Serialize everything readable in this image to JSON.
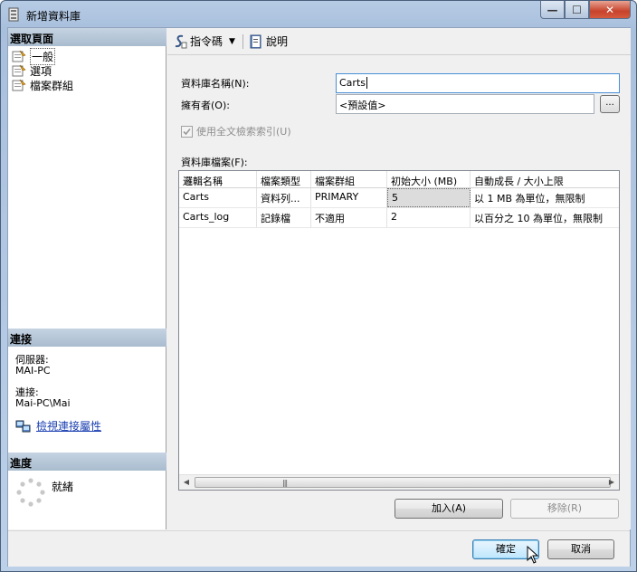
{
  "window": {
    "title": "新增資料庫",
    "buttons": {
      "minimize": "—",
      "maximize": "☐",
      "close": "✕"
    }
  },
  "left_pane": {
    "select_page": {
      "header": "選取頁面",
      "items": [
        {
          "label": "一般",
          "icon": "page-settings-icon",
          "selected": true
        },
        {
          "label": "選項",
          "icon": "page-settings-icon",
          "selected": false
        },
        {
          "label": "檔案群組",
          "icon": "page-settings-icon",
          "selected": false
        }
      ]
    },
    "connection": {
      "header": "連接",
      "server_label": "伺服器:",
      "server_value": "MAI-PC",
      "connection_label": "連接:",
      "connection_value": "Mai-PC\\Mai",
      "view_properties_link": "檢視連接屬性"
    },
    "progress": {
      "header": "進度",
      "status": "就緒"
    }
  },
  "toolbar": {
    "script_label": "指令碼",
    "help_label": "說明"
  },
  "form": {
    "db_name_label": "資料庫名稱(N):",
    "db_name_value": "Carts",
    "owner_label": "擁有者(O):",
    "owner_value": "<預設值>",
    "browse_label": "...",
    "fulltext_label": "使用全文檢索索引(U)",
    "fulltext_checked": true,
    "db_files_label": "資料庫檔案(F):"
  },
  "files_grid": {
    "columns": [
      "邏輯名稱",
      "檔案類型",
      "檔案群組",
      "初始大小 (MB)",
      "自動成長 / 大小上限"
    ],
    "rows": [
      [
        "Carts",
        "資料列...",
        "PRIMARY",
        "5",
        "以 1 MB 為單位，無限制"
      ],
      [
        "Carts_log",
        "記錄檔",
        "不適用",
        "2",
        "以百分之 10 為單位，無限制"
      ]
    ],
    "scrollbar_grip": "|||"
  },
  "grid_buttons": {
    "add": "加入(A)",
    "remove": "移除(R)"
  },
  "footer": {
    "ok": "確定",
    "cancel": "取消"
  },
  "colors": {
    "title_bar": "#a9c0dd",
    "pane_header": "#b7c7d8",
    "link": "#1a3fb0",
    "close_button": "#c7432b"
  }
}
